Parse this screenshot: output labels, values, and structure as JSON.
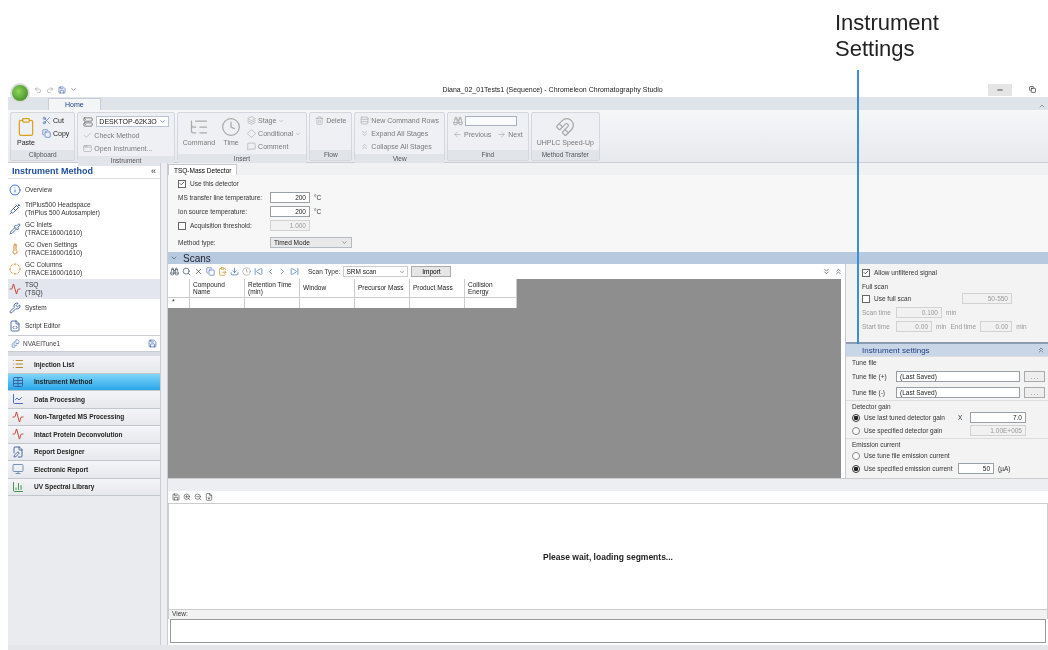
{
  "callout": {
    "text": "Instrument Settings"
  },
  "window": {
    "title": "Diana_02_01Tests1 (Sequence) - Chromeleon Chromatography Studio"
  },
  "ribbon": {
    "tabs": [
      {
        "label": "Home",
        "selected": true
      }
    ],
    "groups": [
      {
        "label": "Clipboard",
        "columns": [
          [
            {
              "kind": "large",
              "label": "Paste",
              "disabled": false
            }
          ],
          [
            {
              "kind": "small",
              "label": "Cut",
              "disabled": false,
              "has_menu": false
            },
            {
              "kind": "small",
              "label": "Copy",
              "disabled": false,
              "has_menu": false
            }
          ]
        ]
      },
      {
        "label": "Instrument",
        "columns": [
          [
            {
              "kind": "dropdown",
              "label": "DESKTOP-62K3O",
              "disabled": false
            },
            {
              "kind": "small",
              "label": "Check Method",
              "disabled": true,
              "has_menu": false
            },
            {
              "kind": "small",
              "label": "Open Instrument...",
              "disabled": true,
              "has_menu": false
            }
          ]
        ]
      },
      {
        "label": "Insert",
        "columns": [
          [
            {
              "kind": "large",
              "label": "Command",
              "disabled": true
            }
          ],
          [
            {
              "kind": "large",
              "label": "Time",
              "disabled": true
            }
          ],
          [
            {
              "kind": "small",
              "label": "Stage",
              "disabled": true,
              "has_menu": true
            },
            {
              "kind": "small",
              "label": "Conditional",
              "disabled": true,
              "has_menu": true
            },
            {
              "kind": "small",
              "label": "Comment",
              "disabled": true,
              "has_menu": false
            }
          ]
        ]
      },
      {
        "label": "Flow",
        "columns": [
          [
            {
              "kind": "small",
              "label": "Delete",
              "disabled": true,
              "has_menu": false
            }
          ]
        ]
      },
      {
        "label": "View",
        "columns": [
          [
            {
              "kind": "small",
              "label": "New Command Rows",
              "disabled": true,
              "has_menu": false
            },
            {
              "kind": "small",
              "label": "Expand All Stages",
              "disabled": true,
              "has_menu": false
            },
            {
              "kind": "small",
              "label": "Collapse All Stages",
              "disabled": true,
              "has_menu": false
            }
          ]
        ]
      },
      {
        "label": "Find",
        "columns": [
          [
            {
              "kind": "search",
              "disabled": false
            },
            {
              "kind": "pair",
              "items": [
                {
                  "label": "Previous",
                  "disabled": true
                },
                {
                  "label": "Next",
                  "disabled": true
                }
              ]
            }
          ]
        ]
      },
      {
        "label": "Method Transfer",
        "columns": [
          [
            {
              "kind": "large",
              "label": "UHPLC Speed-Up",
              "disabled": true
            }
          ]
        ]
      }
    ]
  },
  "navigator": {
    "title": "Instrument Method",
    "collapse": "«",
    "items": [
      {
        "name": "Overview",
        "selected": false
      },
      {
        "name": "TriPlus500 Headspace",
        "module": "(TriPlus 500 Autosampler)",
        "selected": false
      },
      {
        "name": "GC Inlets",
        "module": "(TRACE1600/1610)",
        "selected": false
      },
      {
        "name": "GC Oven Settings",
        "module": "(TRACE1600/1610)",
        "selected": false
      },
      {
        "name": "GC Columns",
        "module": "(TRACE1600/1610)",
        "selected": false
      },
      {
        "name": "TSQ",
        "module": "(TSQ)",
        "selected": true
      },
      {
        "name": "System",
        "selected": false
      },
      {
        "name": "Script Editor",
        "selected": false
      }
    ]
  },
  "sequence_file": {
    "name": "NVAEITune1"
  },
  "nav_buttons": [
    {
      "label": "Injection List",
      "selected": false
    },
    {
      "label": "Instrument Method",
      "selected": true
    },
    {
      "label": "Data Processing",
      "selected": false
    },
    {
      "label": "Non-Targeted MS Processing",
      "selected": false
    },
    {
      "label": "Intact Protein Deconvolution",
      "selected": false
    },
    {
      "label": "Report Designer",
      "selected": false
    },
    {
      "label": "Electronic Report",
      "selected": false
    },
    {
      "label": "UV Spectral Library",
      "selected": false
    }
  ],
  "detector_tabs": [
    {
      "label": "TSQ-Mass Detector",
      "selected": true
    }
  ],
  "detector": {
    "use_detector": {
      "label": "Use this detector",
      "checked": true
    },
    "temperatures": [
      {
        "label": "MS transfer line temperature:",
        "value": "200",
        "unit": "°C"
      },
      {
        "label": "Ion source temperature:",
        "value": "200",
        "unit": "°C"
      }
    ],
    "acquisition_threshold": {
      "label": "Acquisition threshold:",
      "checked": false,
      "value": "1.000"
    },
    "method_type": {
      "label": "Method type:",
      "value": "Timed Mode"
    }
  },
  "scans": {
    "title": "Scans",
    "scan_type_label": "Scan Type:",
    "scan_type": "SRM scan",
    "import_button": "Import",
    "columns": [
      "Compound Name",
      "Retention Time (min)",
      "Window",
      "Precursor Mass",
      "Product Mass",
      "Collision Energy"
    ],
    "new_row_marker": "*"
  },
  "scan_settings": {
    "allow_unfiltered": {
      "label": "Allow unfiltered signal",
      "checked": true
    },
    "full_scan": {
      "title": "Full scan",
      "use_full_scan": {
        "label": "Use full scan",
        "checked": false
      },
      "mass_range": "50-550",
      "scan_time": {
        "label": "Scan time",
        "value": "0.100",
        "unit": "min"
      },
      "start_time": {
        "label": "Start time",
        "value": "0.00",
        "unit": "min"
      },
      "end_time": {
        "label": "End time",
        "value": "0.00",
        "unit": "min"
      }
    }
  },
  "instrument_settings": {
    "title": "Instrument settings",
    "tune_file": {
      "title": "Tune file",
      "files": [
        {
          "label": "Tune file (+)",
          "value": "(Last Saved)",
          "browse": ". . ."
        },
        {
          "label": "Tune file (-)",
          "value": "(Last Saved)",
          "browse": ". . ."
        }
      ]
    },
    "detector_gain": {
      "title": "Detector gain",
      "options": [
        {
          "label": "Use last tuned detector gain",
          "selected": true,
          "factor": "X",
          "value": "7.0"
        },
        {
          "label": "Use specified detector gain",
          "selected": false,
          "value": "1.00E+005"
        }
      ]
    },
    "emission_current": {
      "title": "Emission current",
      "options": [
        {
          "label": "Use tune file emission current",
          "selected": false
        },
        {
          "label": "Use specified emission current",
          "selected": true,
          "value": "50",
          "unit": "(µA)"
        }
      ]
    }
  },
  "results": {
    "message": "Please wait, loading segments...",
    "view_label": "View:"
  }
}
